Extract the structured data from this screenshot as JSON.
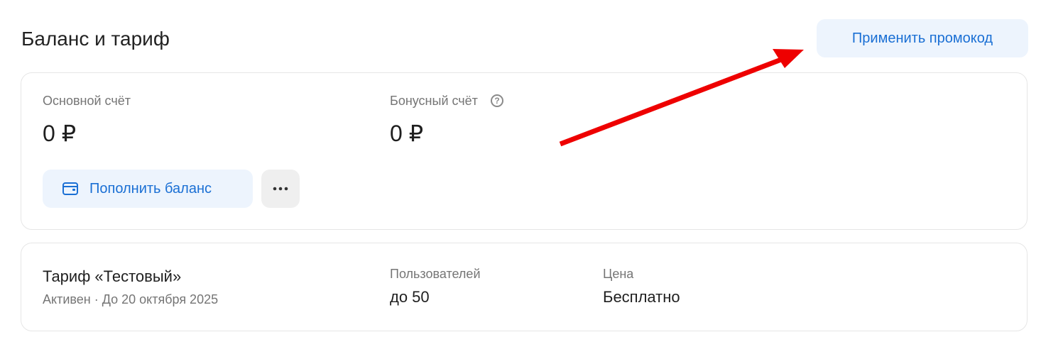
{
  "header": {
    "title": "Баланс и тариф",
    "promo_button_label": "Применить промокод"
  },
  "balance": {
    "main_label": "Основной счёт",
    "main_amount": "0 ₽",
    "bonus_label": "Бонусный счёт",
    "bonus_help_icon": "question-circle-icon",
    "bonus_help_glyph": "?",
    "bonus_amount": "0 ₽",
    "topup_icon": "wallet-icon",
    "topup_label": "Пополнить баланс",
    "more_icon": "more-horizontal-icon"
  },
  "tariff": {
    "title": "Тариф «Тестовый»",
    "status_line": "Активен · До 20 октября 2025",
    "users_label": "Пользователей",
    "users_value": "до 50",
    "price_label": "Цена",
    "price_value": "Бесплатно"
  },
  "annotation": {
    "icon": "red-arrow-icon",
    "color": "#ee0000"
  },
  "colors": {
    "accent": "#1a6fd4",
    "button_bg": "#edf4fd",
    "muted_text": "#757575"
  }
}
